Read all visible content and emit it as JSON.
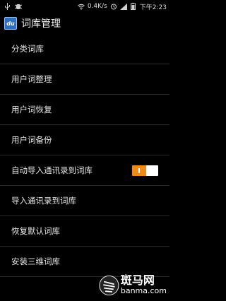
{
  "statusbar": {
    "speed": "0.4K/s",
    "time": "下午2:23",
    "icons": [
      "usb-icon",
      "debug-icon",
      "wifi-icon",
      "alarm-icon",
      "signal-icon",
      "battery-icon"
    ]
  },
  "header": {
    "app_icon_text": "du",
    "title": "词库管理"
  },
  "menu": {
    "items": [
      {
        "label": "分类词库"
      },
      {
        "label": "用户词整理"
      },
      {
        "label": "用户词恢复"
      },
      {
        "label": "用户词备份"
      },
      {
        "label": "自动导入通讯录到词库",
        "toggle": true
      },
      {
        "label": "导入通讯录到词库"
      },
      {
        "label": "恢复默认词库"
      },
      {
        "label": "安装三维词库"
      }
    ]
  },
  "watermark": {
    "cn": "斑马网",
    "en": "banma.com"
  },
  "colors": {
    "accent": "#f08a17",
    "background": "#000000",
    "divider": "#2a2a2a"
  }
}
